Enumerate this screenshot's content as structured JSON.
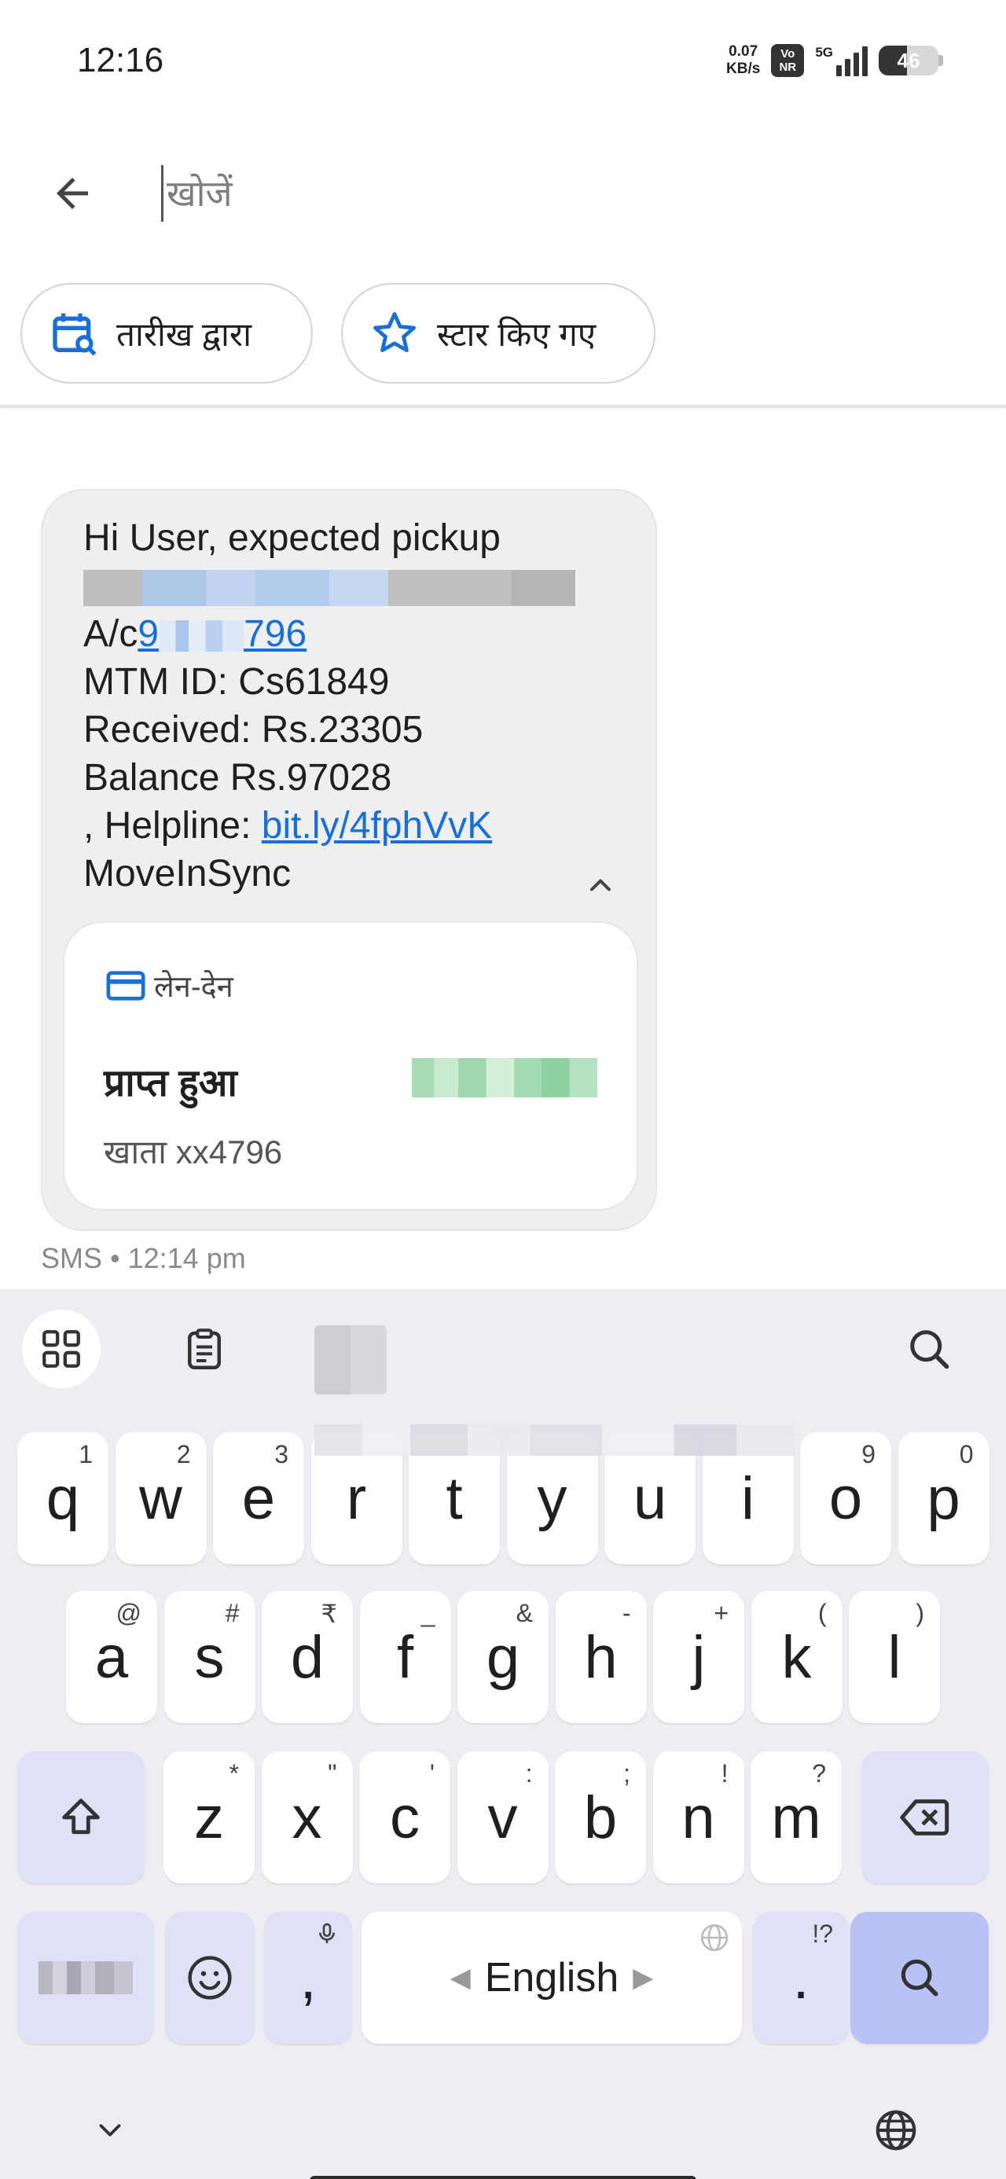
{
  "status_bar": {
    "time": "12:16",
    "net_speed_value": "0.07",
    "net_speed_unit": "KB/s",
    "volte_top": "Vo",
    "volte_bottom": "NR",
    "network_type": "5G",
    "battery_level": "46"
  },
  "search": {
    "placeholder": "खोजें"
  },
  "filters": [
    {
      "label": "तारीख द्वारा",
      "icon": "calendar-search-icon"
    },
    {
      "label": "स्टार किए गए",
      "icon": "star-outline-icon"
    }
  ],
  "message": {
    "line1": "Hi User, expected pickup",
    "account_prefix": "A/c",
    "account_link_start": "9",
    "account_link_end": "796",
    "mtm_id": "MTM ID: Cs61849",
    "received": "Received: Rs.23305",
    "balance": "Balance Rs.97028",
    "helpline_prefix": ", Helpline: ",
    "helpline_link": "bit.ly/4fphVvK",
    "sender": "MoveInSync",
    "meta": "SMS • 12:14 pm",
    "card": {
      "type_label": "लेन-देन",
      "title": "प्राप्त हुआ",
      "account": "खाता xx4796"
    }
  },
  "keyboard": {
    "row1": [
      {
        "k": "q",
        "h": "1"
      },
      {
        "k": "w",
        "h": "2"
      },
      {
        "k": "e",
        "h": "3"
      },
      {
        "k": "r",
        "h": ""
      },
      {
        "k": "t",
        "h": ""
      },
      {
        "k": "y",
        "h": ""
      },
      {
        "k": "u",
        "h": ""
      },
      {
        "k": "i",
        "h": ""
      },
      {
        "k": "o",
        "h": "9"
      },
      {
        "k": "p",
        "h": "0"
      }
    ],
    "row2": [
      {
        "k": "a",
        "h": "@"
      },
      {
        "k": "s",
        "h": "#"
      },
      {
        "k": "d",
        "h": "₹"
      },
      {
        "k": "f",
        "h": "_"
      },
      {
        "k": "g",
        "h": "&"
      },
      {
        "k": "h",
        "h": "-"
      },
      {
        "k": "j",
        "h": "+"
      },
      {
        "k": "k",
        "h": "("
      },
      {
        "k": "l",
        "h": ")"
      }
    ],
    "row3": [
      {
        "k": "z",
        "h": "*"
      },
      {
        "k": "x",
        "h": "\""
      },
      {
        "k": "c",
        "h": "'"
      },
      {
        "k": "v",
        "h": ":"
      },
      {
        "k": "b",
        "h": ";"
      },
      {
        "k": "n",
        "h": "!"
      },
      {
        "k": "m",
        "h": "?"
      }
    ],
    "comma": ",",
    "space_label": "English",
    "period": ".",
    "period_hint": "!?",
    "colors": {
      "background": "#efecf4",
      "modifier": "#dfe1f6",
      "action": "#b9c2f6"
    }
  }
}
